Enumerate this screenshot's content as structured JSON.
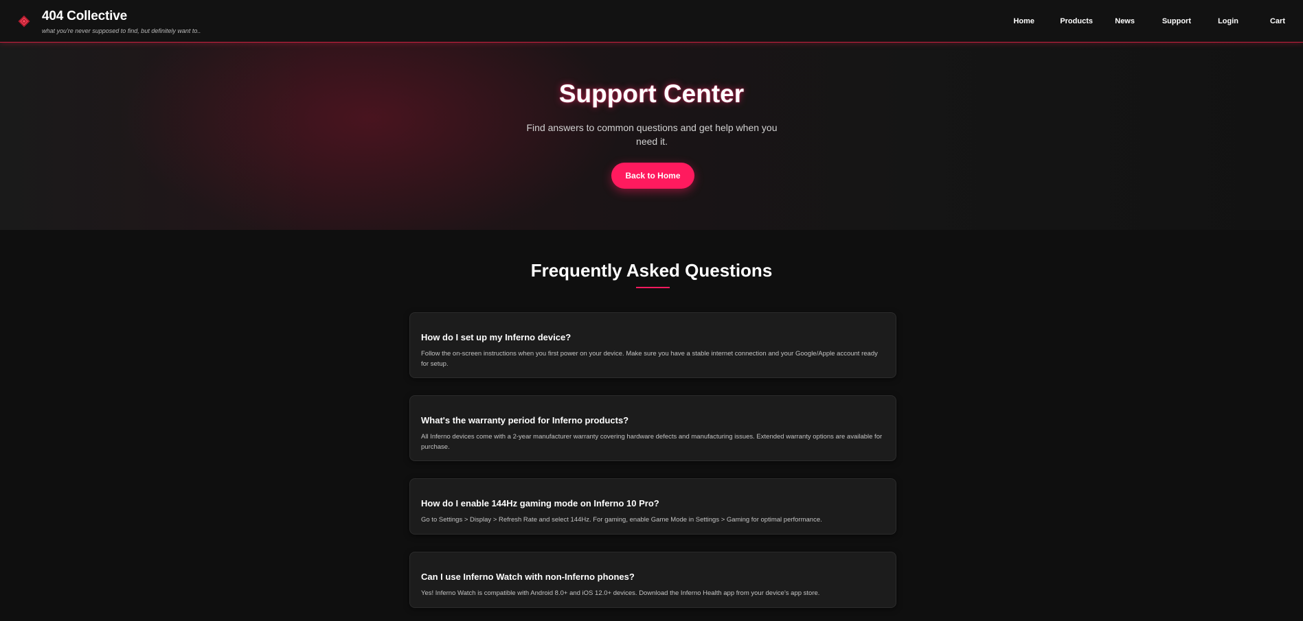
{
  "brand": {
    "title": "404 Collective",
    "tagline": "what you're never supposed to find, but definitely want to.."
  },
  "nav": [
    "Home",
    "Products",
    "News",
    "Support",
    "Login",
    "Cart"
  ],
  "hero": {
    "title": "Support Center",
    "subtitle": "Find answers to common questions and get help when you need it.",
    "button": "Back to Home"
  },
  "faq": {
    "title": "Frequently Asked Questions",
    "items": [
      {
        "q": "How do I set up my Inferno device?",
        "a": "Follow the on-screen instructions when you first power on your device. Make sure you have a stable internet connection and your Google/Apple account ready for setup."
      },
      {
        "q": "What's the warranty period for Inferno products?",
        "a": "All Inferno devices come with a 2-year manufacturer warranty covering hardware defects and manufacturing issues. Extended warranty options are available for purchase."
      },
      {
        "q": "How do I enable 144Hz gaming mode on Inferno 10 Pro?",
        "a": "Go to Settings > Display > Refresh Rate and select 144Hz. For gaming, enable Game Mode in Settings > Gaming for optimal performance."
      },
      {
        "q": "Can I use Inferno Watch with non-Inferno phones?",
        "a": "Yes! Inferno Watch is compatible with Android 8.0+ and iOS 12.0+ devices. Download the Inferno Health app from your device's app store."
      }
    ]
  },
  "colors": {
    "accent": "#ff1a5e",
    "background": "#0f0f0f",
    "card": "#1c1c1c"
  }
}
